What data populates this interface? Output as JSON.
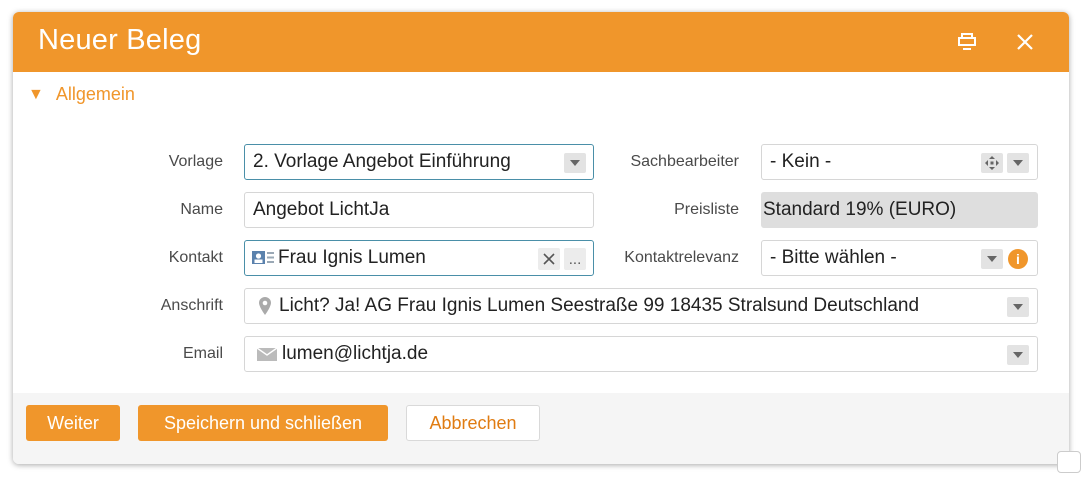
{
  "dialog": {
    "title": "Neuer Beleg",
    "section_label": "Allgemein"
  },
  "labels": {
    "vorlage": "Vorlage",
    "name": "Name",
    "kontakt": "Kontakt",
    "anschrift": "Anschrift",
    "email": "Email",
    "sachbearbeiter": "Sachbearbeiter",
    "preisliste": "Preisliste",
    "kontaktrelevanz": "Kontaktrelevanz"
  },
  "values": {
    "vorlage": "2. Vorlage Angebot Einführung",
    "name": "Angebot LichtJa",
    "kontakt": "Frau Ignis Lumen",
    "anschrift": "Licht? Ja! AG Frau Ignis Lumen Seestraße 99 18435 Stralsund Deutschland",
    "email": "lumen@lichtja.de",
    "sachbearbeiter": "- Kein -",
    "preisliste": "Standard 19% (EURO)",
    "kontaktrelevanz": "- Bitte wählen -"
  },
  "buttons": {
    "weiter": "Weiter",
    "speichern": "Speichern und schließen",
    "abbrechen": "Abbrechen",
    "kontakt_more": "..."
  },
  "colors": {
    "accent": "#f0962b",
    "focus_border": "#4a8fa8"
  },
  "icons": {
    "restore": "window-restore-icon",
    "close": "close-icon",
    "contact_card": "contact-card-icon",
    "location": "location-pin-icon",
    "mail": "envelope-icon",
    "info": "info-icon",
    "move": "move-arrows-icon"
  }
}
